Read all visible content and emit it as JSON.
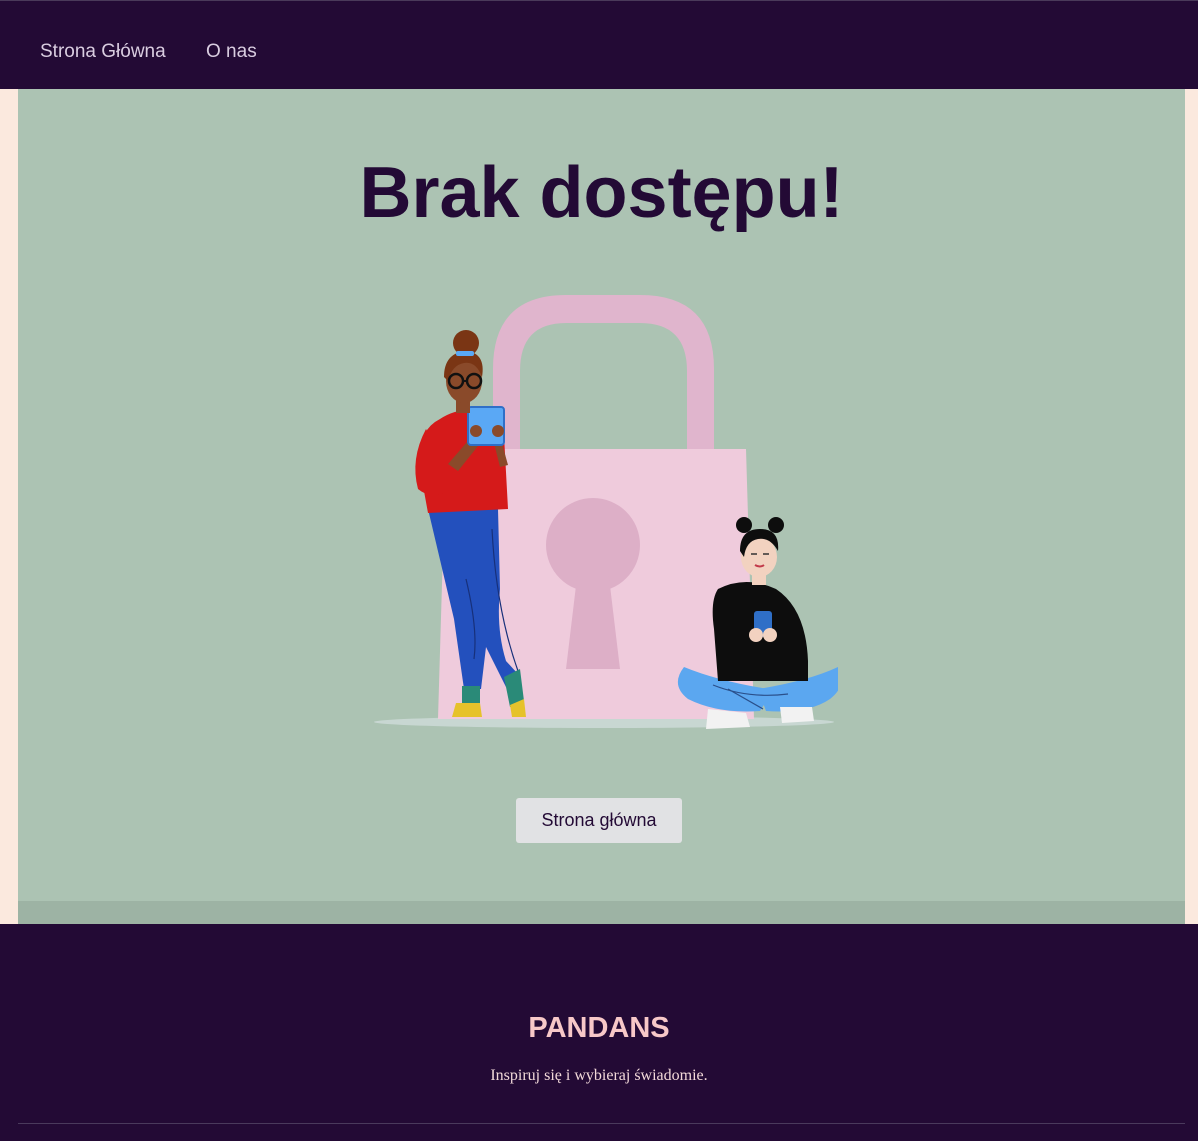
{
  "nav": {
    "home_label": "Strona Główna",
    "about_label": "O nas"
  },
  "main": {
    "headline": "Brak dostępu!",
    "illustration_icon": "padlock-people-illustration",
    "button_label": "Strona główna"
  },
  "footer": {
    "brand": "PANDANS",
    "tagline": "Inspiruj się i wybieraj świadomie."
  },
  "colors": {
    "nav_bg": "#230a35",
    "main_bg": "#acc3b3",
    "page_bg": "#fbe9de",
    "brand_accent": "#f7c8c8",
    "lock_pink": "#efcbdc"
  }
}
